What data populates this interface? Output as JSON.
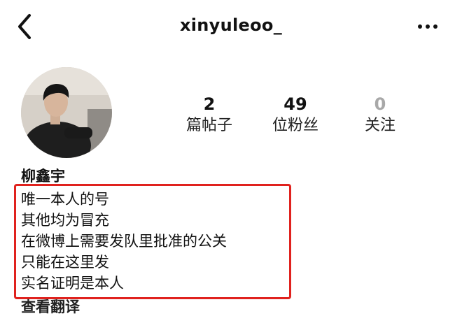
{
  "header": {
    "username": "xinyuleoo_",
    "back_icon": "chevron-left-icon",
    "more_icon": "more-horizontal-icon"
  },
  "profile": {
    "avatar": "profile-photo",
    "display_name": "柳鑫宇",
    "stats": [
      {
        "value": "2",
        "label": "篇帖子"
      },
      {
        "value": "49",
        "label": "位粉丝"
      },
      {
        "value": "0",
        "label": "关注"
      }
    ],
    "bio_lines": [
      "唯一本人的号",
      "其他均为冒充",
      "在微博上需要发队里批准的公关",
      "只能在这里发",
      "实名证明是本人"
    ],
    "translate_label": "查看翻译"
  },
  "colors": {
    "highlight_border": "#e0221e",
    "muted_stat": "#a8a8a8"
  }
}
